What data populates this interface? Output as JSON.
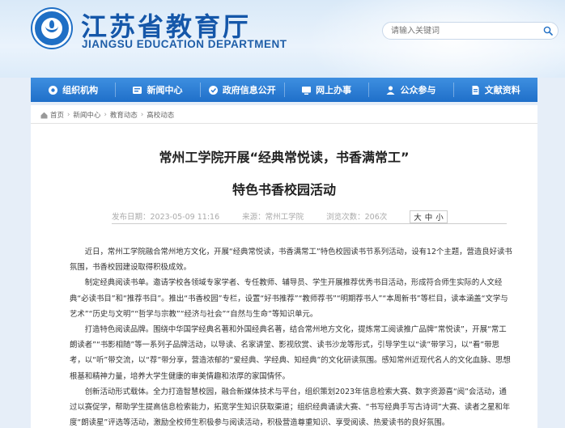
{
  "header": {
    "title": "江苏省教育厅",
    "subtitle": "JIANGSU EDUCATION DEPARTMENT",
    "search_placeholder": "请输入关键词"
  },
  "nav": [
    {
      "label": "组织机构",
      "icon": "org-icon"
    },
    {
      "label": "新闻中心",
      "icon": "news-icon"
    },
    {
      "label": "政府信息公开",
      "icon": "gov-info-icon"
    },
    {
      "label": "网上办事",
      "icon": "online-service-icon"
    },
    {
      "label": "公众参与",
      "icon": "public-icon"
    },
    {
      "label": "文献资料",
      "icon": "document-icon"
    }
  ],
  "breadcrumb": [
    "首页",
    "新闻中心",
    "教育动态",
    "高校动态"
  ],
  "article": {
    "title_line1": "常州工学院开展“经典常悦读，书香满常工”",
    "title_line2": "特色书香校园活动",
    "published": "发布日期：2023-05-09 11:16",
    "source": "来源：常州工学院",
    "views": "浏览次数：206次",
    "font_size_label": "大",
    "font_size_mid": "中",
    "font_size_small": "小",
    "paragraphs": [
      "近日，常州工学院融合常州地方文化，开展“经典常悦读，书香满常工”特色校园读书节系列活动，设有12个主题，营造良好读书氛围，书香校园建设取得积极成效。",
      "制定经典阅读书单。邀请学校各领域专家学者、专任教师、辅导员、学生开展推荐优秀书目活动，形成符合师生实际的人文经典“必读书目”和“推荐书目”。推出“书香校园”专栏，设置“好书推荐”“教师荐书”“明期荐书人”“本周新书”等栏目，读本涵盖“文学与艺术”“历史与文明”“哲学与宗教”“经济与社会”“自然与生命”等知识单元。",
      "打造特色阅读品牌。围绕中华国学经典名著和外国经典名著，结合常州地方文化，提炼常工阅读推广品牌“常悦读”，开展“常工朗读者”“书影相随”等一系列子品牌活动，以导读、名家讲堂、影视欣赏、读书沙龙等形式，引导学生以“读”带学习，以“看”带思考，以“听”带交流，以“荐”带分享，营造浓郁的“爱经典、学经典、知经典”的文化研读氛围。感知常州近现代名人的文化血脉、思想根基和精神力量，培养大学生健康的审美情趣和浓厚的家国情怀。",
      "创新活动形式载体。全力打造智慧校园，融合新媒体技术与平台，组织策划2023年信息检索大赛、数字资源喜“阅”会活动，通过以赛促学，帮助学生提高信息检索能力，拓宽学生知识获取渠道；组织经典诵读大赛、“书写经典手写古诗词”大赛、读者之星和年度“朗读星”评选等活动，激励全校师生积极参与阅读活动，积极营造尊重知识、享受阅读、热爱读书的良好氛围。"
    ]
  },
  "colors": {
    "nav": "#1f6fc9",
    "brand": "#1557a9",
    "background": "#e6eef8"
  }
}
